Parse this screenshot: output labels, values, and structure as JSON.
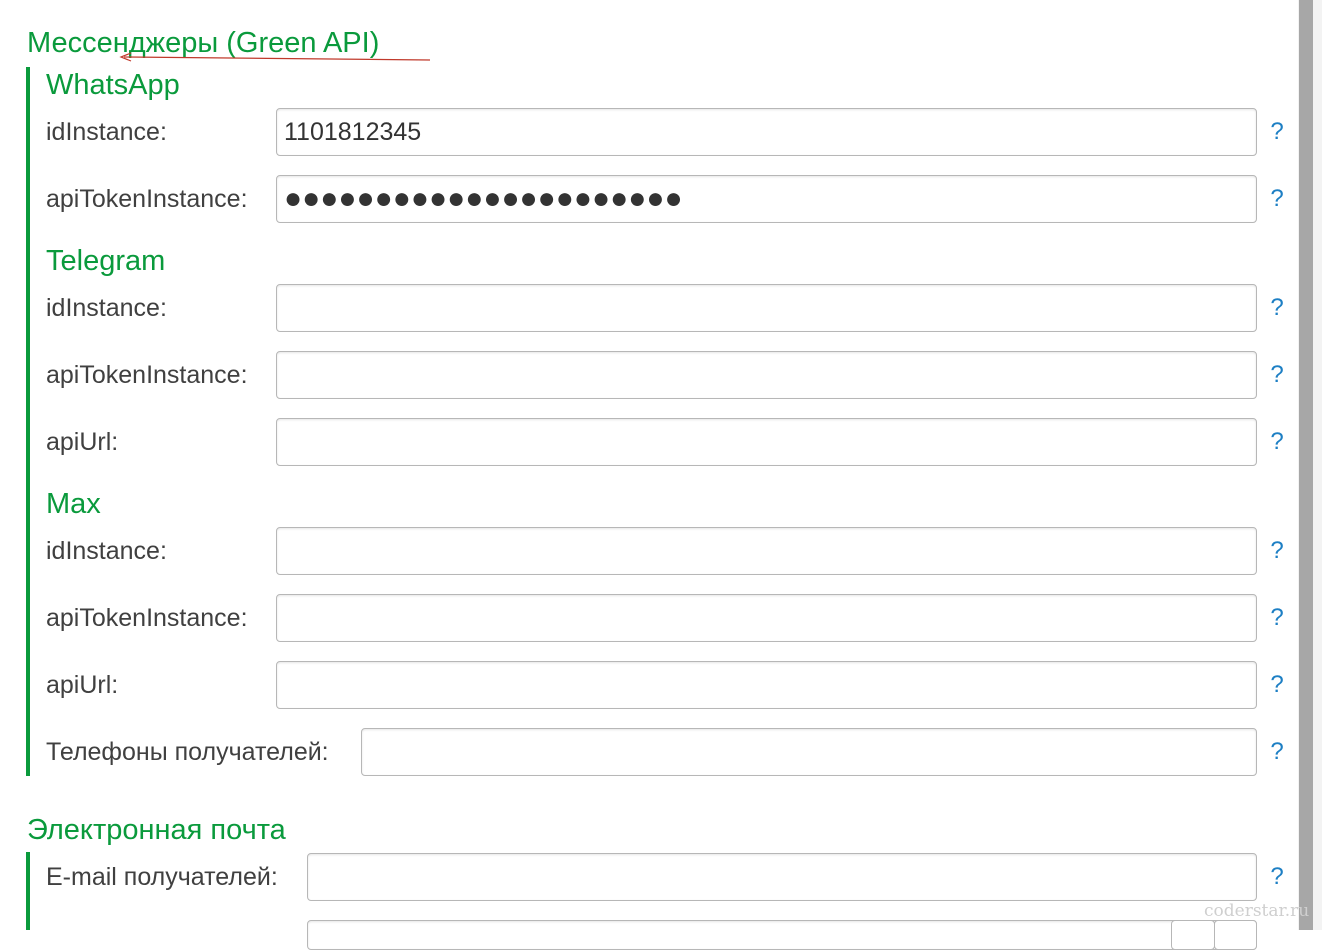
{
  "messengers": {
    "title": "Мессенджеры (Green API)",
    "whatsapp": {
      "title": "WhatsApp",
      "id_label": "idInstance:",
      "id_value": "1101812345",
      "token_label": "apiTokenInstance:",
      "token_value": "●●●●●●●●●●●●●●●●●●●●●●"
    },
    "telegram": {
      "title": "Telegram",
      "id_label": "idInstance:",
      "id_value": "",
      "token_label": "apiTokenInstance:",
      "token_value": "",
      "url_label": "apiUrl:",
      "url_value": ""
    },
    "max": {
      "title": "Max",
      "id_label": "idInstance:",
      "id_value": "",
      "token_label": "apiTokenInstance:",
      "token_value": "",
      "url_label": "apiUrl:",
      "url_value": ""
    },
    "phones_label": "Телефоны получателей:",
    "phones_value": ""
  },
  "email": {
    "title": "Электронная почта",
    "recipients_label": "E-mail получателей:",
    "recipients_value": ""
  },
  "help_label": "?",
  "watermark": "coderstar.ru",
  "colors": {
    "accent_green": "#0a9a3c",
    "help_blue": "#1d7fc4",
    "annotation_red": "#c0392b"
  }
}
